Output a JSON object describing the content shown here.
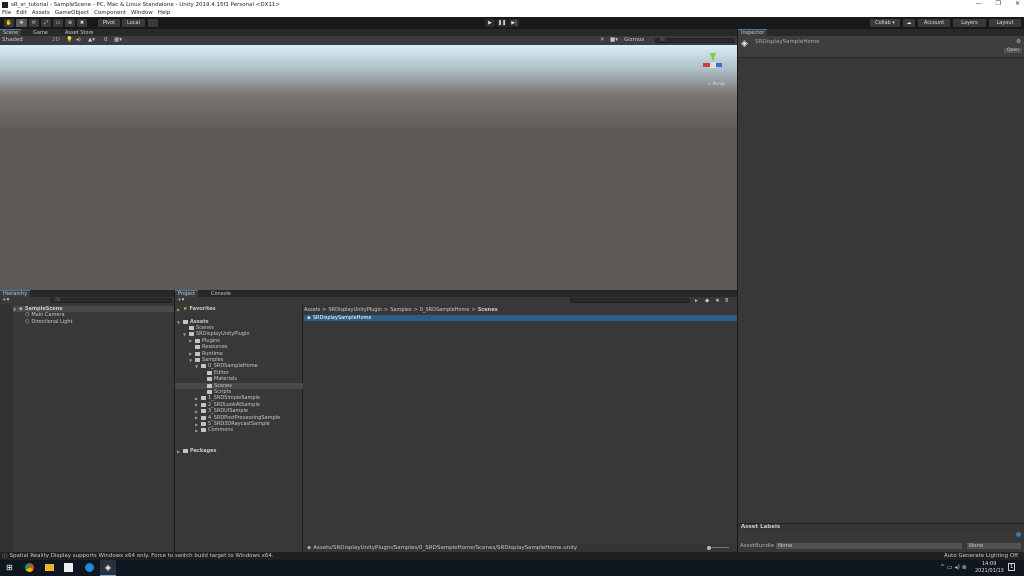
{
  "window": {
    "title": "sR_sr_tutorial - SampleScene - PC, Mac & Linux Standalone - Unity 2019.4.15f1 Personal <DX11>",
    "controls": [
      "—",
      "❐",
      "✕"
    ]
  },
  "menu": [
    "File",
    "Edit",
    "Assets",
    "GameObject",
    "Component",
    "Window",
    "Help"
  ],
  "toolbar": {
    "tools": [
      "✋",
      "✥",
      "⟳",
      "⤢",
      "▭",
      "⊕",
      "✖"
    ],
    "pivot": "Pivot",
    "local": "Local",
    "play": "▶",
    "pause": "❚❚",
    "step": "▶|",
    "collab": "Collab ▾",
    "account": "Account",
    "layers": "Layers",
    "layout": "Layout"
  },
  "scene": {
    "tabs": [
      "Scene",
      "Game",
      "Asset Store"
    ],
    "shading": "Shaded",
    "mode2d": "2D",
    "gizmos": "Gizmos",
    "search_placeholder": "All",
    "persp": "< Persp",
    "fx_count": "0",
    "sky_color": "#d8eef5",
    "ground_color": "#5f5a56"
  },
  "hierarchy": {
    "title": "Hierarchy",
    "search_placeholder": "All",
    "scene": "SampleScene",
    "items": [
      "Main Camera",
      "Directional Light"
    ]
  },
  "project": {
    "tabs": [
      "Project",
      "Console"
    ],
    "favorites": "Favorites",
    "assets": "Assets",
    "packages": "Packages",
    "tree": [
      {
        "label": "Scenes",
        "depth": 1,
        "arrow": ""
      },
      {
        "label": "SRDisplayUnityPlugin",
        "depth": 1,
        "arrow": "▼"
      },
      {
        "label": "Plugins",
        "depth": 2,
        "arrow": "▶"
      },
      {
        "label": "Resources",
        "depth": 2,
        "arrow": ""
      },
      {
        "label": "Runtime",
        "depth": 2,
        "arrow": "▶"
      },
      {
        "label": "Samples",
        "depth": 2,
        "arrow": "▼"
      },
      {
        "label": "0_SRDSampleHome",
        "depth": 3,
        "arrow": "▼"
      },
      {
        "label": "Editor",
        "depth": 4,
        "arrow": ""
      },
      {
        "label": "Materials",
        "depth": 4,
        "arrow": ""
      },
      {
        "label": "Scenes",
        "depth": 4,
        "arrow": "",
        "selected": true
      },
      {
        "label": "Scripts",
        "depth": 4,
        "arrow": ""
      },
      {
        "label": "1_SRDSimpleSample",
        "depth": 3,
        "arrow": "▶"
      },
      {
        "label": "2_SRDLookAtSample",
        "depth": 3,
        "arrow": "▶"
      },
      {
        "label": "3_SRDUISample",
        "depth": 3,
        "arrow": "▶"
      },
      {
        "label": "4_SRDPostProcessingSample",
        "depth": 3,
        "arrow": "▶"
      },
      {
        "label": "5_SRD3DRaycastSample",
        "depth": 3,
        "arrow": "▶"
      },
      {
        "label": "Commons",
        "depth": 3,
        "arrow": "▶"
      }
    ],
    "breadcrumb": [
      "Assets",
      "SRDisplayUnityPlugin",
      "Samples",
      "0_SRDSampleHome",
      "Scenes"
    ],
    "files": [
      "SRDisplaySampleHome"
    ],
    "path": "Assets/SRDisplayUnityPlugin/Samples/0_SRDSampleHome/Scenes/SRDisplaySampleHome.unity",
    "hidden_count": "8"
  },
  "inspector": {
    "title": "Inspector",
    "asset_name": "SRDisplaySampleHome",
    "open": "Open",
    "asset_labels": "Asset Labels",
    "assetbundle_label": "AssetBundle",
    "assetbundle": "None",
    "variant": "None"
  },
  "status": {
    "message": "Spatial Reality Display supports Windows x64 only. Force to switch build target to Windows x64.",
    "lighting": "Auto Generate Lighting Off"
  },
  "taskbar": {
    "time": "14:09",
    "date": "2021/01/13",
    "notif": "1"
  },
  "colors": {
    "accent": "#3a79bb",
    "selection": "#2c5d87"
  }
}
